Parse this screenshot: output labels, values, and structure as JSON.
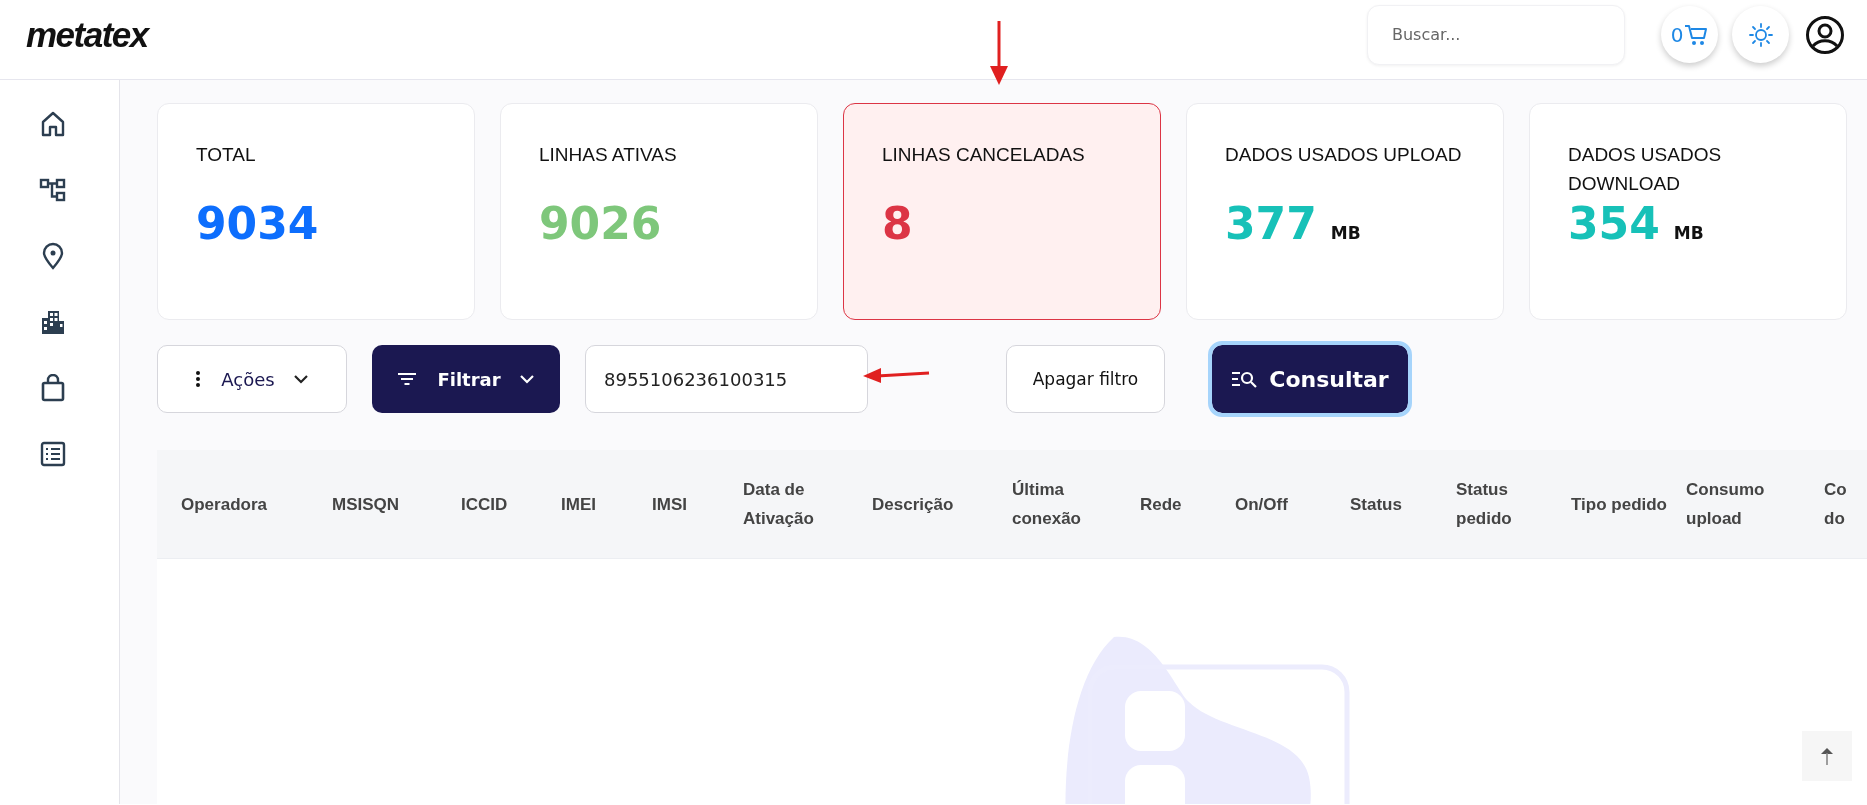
{
  "header": {
    "logo": "metatex",
    "search": {
      "placeholder": "Buscar..."
    },
    "cart_count": "0"
  },
  "sidebar": {
    "items": [
      {
        "kind": "home"
      },
      {
        "kind": "hierarchy"
      },
      {
        "kind": "location"
      },
      {
        "kind": "building"
      },
      {
        "kind": "bag"
      },
      {
        "kind": "list"
      }
    ]
  },
  "cards": [
    {
      "label": "TOTAL",
      "value": "9034",
      "color": "#0d6efd",
      "selected": false
    },
    {
      "label": "LINHAS ATIVAS",
      "value": "9026",
      "color": "#7ec77b",
      "selected": false
    },
    {
      "label": "LINHAS CANCELADAS",
      "value": "8",
      "color": "#dc3545",
      "selected": true
    },
    {
      "label": "DADOS USADOS UPLOAD",
      "value": "377",
      "unit": "MB",
      "color": "#17c1b8",
      "selected": false
    },
    {
      "label": "DADOS USADOS DOWNLOAD",
      "value": "354",
      "unit": "MB",
      "color": "#17c1b8",
      "selected": false
    }
  ],
  "toolbar": {
    "actions": "Ações",
    "filter": "Filtrar",
    "query": "8955106236100315",
    "clear": "Apagar filtro",
    "submit": "Consultar"
  },
  "table": {
    "columns": [
      "Operadora",
      "MSISQN",
      "ICCID",
      "IMEI",
      "IMSI",
      "Data de Ativação",
      "Descrição",
      "Última conexão",
      "Rede",
      "On/Off",
      "Status",
      "Status pedido",
      "Tipo pedido",
      "Consumo upload",
      "Co do"
    ]
  }
}
